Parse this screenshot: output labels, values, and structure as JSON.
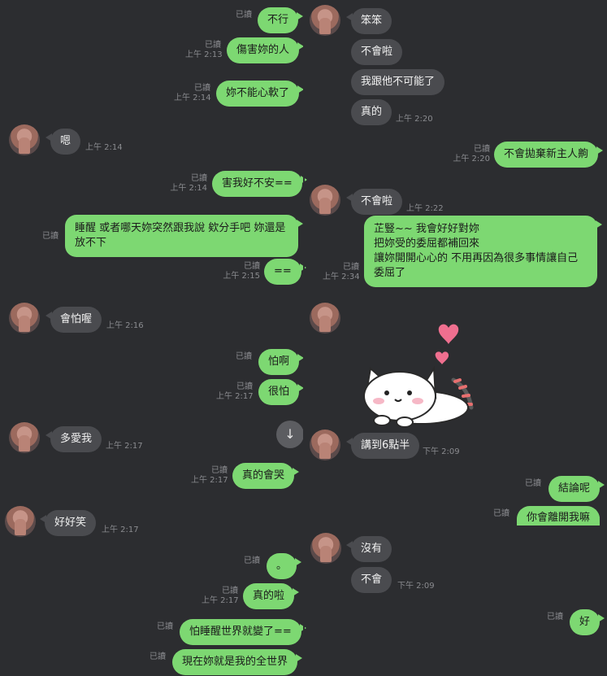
{
  "left_pane": {
    "messages": [
      {
        "text": "不行",
        "read": "已讀",
        "time": ""
      },
      {
        "text": "傷害妳的人",
        "read": "已讀",
        "time": "上午 2:13"
      },
      {
        "text": "妳不能心軟了",
        "read": "已讀",
        "time": "上午 2:14"
      },
      {
        "text": "嗯",
        "time": "上午 2:14"
      },
      {
        "text": "害我好不安==",
        "read": "已讀",
        "time": "上午 2:14"
      },
      {
        "text": "睡醒 或者哪天妳突然跟我說 欸分手吧 妳還是放不下",
        "read": "已讀",
        "time": ""
      },
      {
        "text": "==",
        "read": "已讀",
        "time": "上午 2:15"
      },
      {
        "text": "會怕喔",
        "time": "上午 2:16"
      },
      {
        "text": "怕啊",
        "read": "已讀",
        "time": ""
      },
      {
        "text": "很怕",
        "read": "已讀",
        "time": "上午 2:17"
      },
      {
        "text": "多愛我",
        "time": "上午 2:17"
      },
      {
        "text": "真的會哭",
        "read": "已讀",
        "time": "上午 2:17"
      },
      {
        "text": "好好笑",
        "time": "上午 2:17"
      },
      {
        "text": "。",
        "read": "已讀",
        "time": ""
      },
      {
        "text": "真的啦",
        "read": "已讀",
        "time": "上午 2:17"
      },
      {
        "text": "怕睡醒世界就變了==",
        "read": "已讀",
        "time": ""
      },
      {
        "text": "現在妳就是我的全世界",
        "read": "已讀",
        "time": ""
      }
    ]
  },
  "right_pane": {
    "messages": [
      {
        "text": "笨笨",
        "time": ""
      },
      {
        "text": "不會啦",
        "time": ""
      },
      {
        "text": "我跟他不可能了",
        "time": ""
      },
      {
        "text": "真的",
        "time": "上午 2:20"
      },
      {
        "text": "不會拋棄新主人齁",
        "read": "已讀",
        "time": "上午 2:20"
      },
      {
        "text": "不會啦",
        "time": "上午 2:22"
      },
      {
        "text": "芷豎~~ 我會好好對妳\n把妳受的委屈都補回來\n讓妳開開心心的 不用再因為很多事情讓自己委屈了",
        "read": "已讀",
        "time": "上午 2:34"
      },
      {
        "text": "講到6點半",
        "time": "下午 2:09"
      },
      {
        "text": "結論呢",
        "read": "已讀",
        "time": ""
      },
      {
        "text": "你會離開我嘛",
        "read": "已讀",
        "time": ""
      },
      {
        "text": "沒有",
        "time": ""
      },
      {
        "text": "不會",
        "time": "下午 2:09"
      },
      {
        "text": "好",
        "read": "已讀",
        "time": ""
      }
    ]
  },
  "colors": {
    "background": "#2c2d30",
    "sent_bubble": "#7dd872",
    "received_bubble": "#4a4b4f",
    "meta_text": "#8a8b8f"
  },
  "icons": {
    "scroll_down": "↓",
    "avatar": "avatar",
    "sticker": "cat-sticker"
  }
}
